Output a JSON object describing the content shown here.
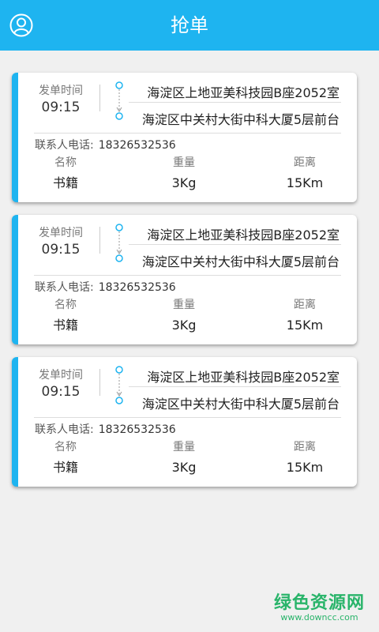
{
  "header": {
    "title": "抢单"
  },
  "orders": [
    {
      "time_label": "发单时间",
      "time": "09:15",
      "from": "海淀区上地亚美科技园B座2052室",
      "to": "海淀区中关村大街中科大厦5层前台",
      "contact_label": "联系人电话:",
      "phone": "18326532536",
      "name_label": "名称",
      "name": "书籍",
      "weight_label": "重量",
      "weight": "3Kg",
      "distance_label": "距离",
      "distance": "15Km"
    },
    {
      "time_label": "发单时间",
      "time": "09:15",
      "from": "海淀区上地亚美科技园B座2052室",
      "to": "海淀区中关村大街中科大厦5层前台",
      "contact_label": "联系人电话:",
      "phone": "18326532536",
      "name_label": "名称",
      "name": "书籍",
      "weight_label": "重量",
      "weight": "3Kg",
      "distance_label": "距离",
      "distance": "15Km"
    },
    {
      "time_label": "发单时间",
      "time": "09:15",
      "from": "海淀区上地亚美科技园B座2052室",
      "to": "海淀区中关村大街中科大厦5层前台",
      "contact_label": "联系人电话:",
      "phone": "18326532536",
      "name_label": "名称",
      "name": "书籍",
      "weight_label": "重量",
      "weight": "3Kg",
      "distance_label": "距离",
      "distance": "15Km"
    }
  ],
  "watermark": {
    "main": "绿色资源网",
    "sub": "www.downcc.com"
  },
  "colors": {
    "accent": "#1eb4f0",
    "watermark": "#29b46a"
  },
  "icons": {
    "user": "user-icon",
    "route": "route-dots-icon"
  }
}
